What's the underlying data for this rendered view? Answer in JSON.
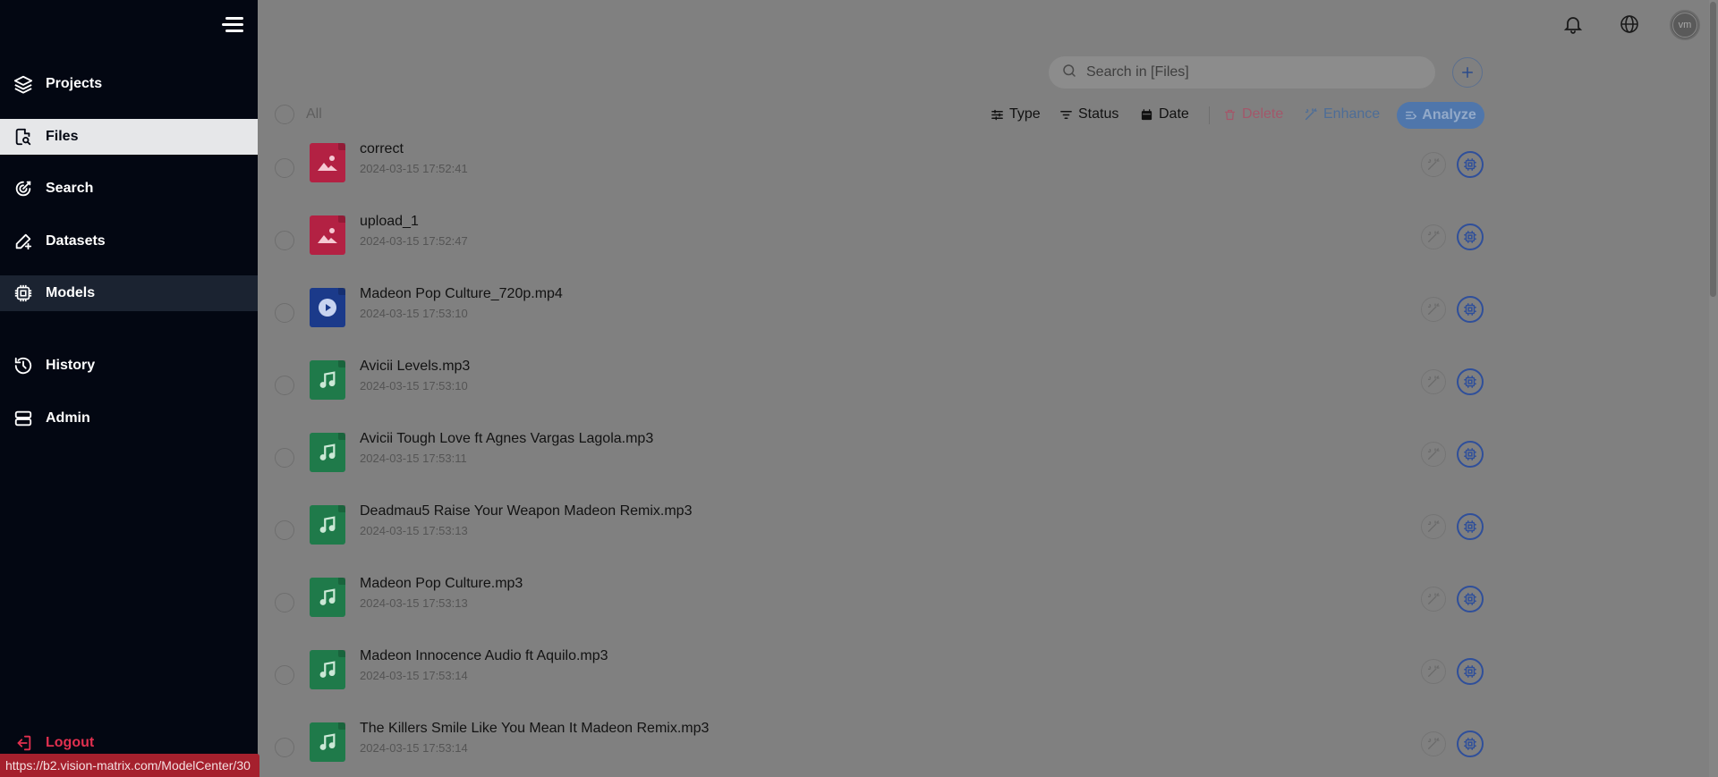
{
  "sidebar": {
    "items": [
      {
        "label": "Projects",
        "icon": "layers-icon"
      },
      {
        "label": "Files",
        "icon": "file-search-icon"
      },
      {
        "label": "Search",
        "icon": "target-icon"
      },
      {
        "label": "Datasets",
        "icon": "pen-plus-icon"
      },
      {
        "label": "Models",
        "icon": "chip-icon"
      },
      {
        "label": "History",
        "icon": "history-icon"
      },
      {
        "label": "Admin",
        "icon": "server-icon"
      }
    ],
    "active": "Files",
    "hovered": "Models",
    "logout_label": "Logout"
  },
  "header": {
    "avatar_initials": "vm"
  },
  "search": {
    "placeholder": "Search in [Files]"
  },
  "toolbar": {
    "select_all_label": "All",
    "type_label": "Type",
    "status_label": "Status",
    "date_label": "Date",
    "delete_label": "Delete",
    "enhance_label": "Enhance",
    "analyze_label": "Analyze"
  },
  "files": [
    {
      "name": "correct",
      "date": "2024-03-15 17:52:41",
      "kind": "image"
    },
    {
      "name": "upload_1",
      "date": "2024-03-15 17:52:47",
      "kind": "image"
    },
    {
      "name": "Madeon Pop Culture_720p.mp4",
      "date": "2024-03-15 17:53:10",
      "kind": "video"
    },
    {
      "name": "Avicii Levels.mp3",
      "date": "2024-03-15 17:53:10",
      "kind": "audio"
    },
    {
      "name": "Avicii Tough Love ft Agnes Vargas Lagola.mp3",
      "date": "2024-03-15 17:53:11",
      "kind": "audio"
    },
    {
      "name": "Deadmau5 Raise Your Weapon Madeon Remix.mp3",
      "date": "2024-03-15 17:53:13",
      "kind": "audio"
    },
    {
      "name": "Madeon Pop Culture.mp3",
      "date": "2024-03-15 17:53:13",
      "kind": "audio"
    },
    {
      "name": "Madeon Innocence Audio ft Aquilo.mp3",
      "date": "2024-03-15 17:53:14",
      "kind": "audio"
    },
    {
      "name": "The Killers Smile Like You Mean It Madeon Remix.mp3",
      "date": "2024-03-15 17:53:14",
      "kind": "audio"
    }
  ],
  "status_bar": {
    "url": "https://b2.vision-matrix.com/ModelCenter/30"
  },
  "colors": {
    "sidebar_bg": "#030712",
    "overlay_bg": "#808080",
    "image_file": "#b32143",
    "video_file": "#1b3a8a",
    "audio_file": "#1f7a4a",
    "logout": "#e1304f",
    "accent": "#4f76ab"
  }
}
